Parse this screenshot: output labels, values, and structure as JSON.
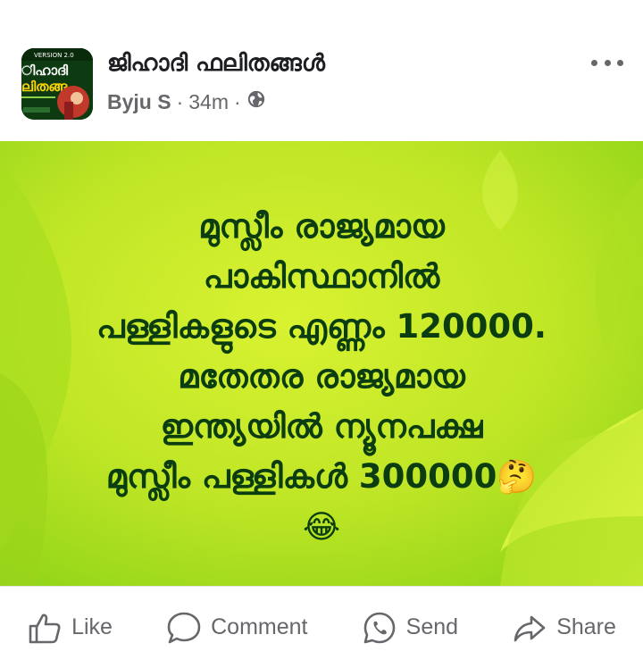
{
  "post": {
    "group_name": "ജിഹാദി ഫലിതങ്ങൾ",
    "author": "Byju S",
    "separator": "·",
    "time": "34m",
    "privacy_icon": "globe-icon",
    "more_icon": "more-options-icon",
    "avatar": {
      "badge_text": "VERSION 2.0",
      "title_line1": "ിഹാദി",
      "title_line2": "ലിതങ്ങ"
    },
    "text_lines": [
      "മുസ്ലീം രാജ്യമായ",
      "പാകിസ്ഥാനിൽ",
      "പള്ളികളുടെ എണ്ണം 120000.",
      "മതേതര രാജ്യമായ",
      "ഇന്ത്യയിൽ ന്യൂനപക്ഷ",
      "മുസ്ലീം പള്ളികൾ 300000"
    ],
    "emoji_thinking": "🤔",
    "emoji_laughing": "😂",
    "colors": {
      "text": "#0b3d10",
      "background_light": "#d7f02e",
      "background_dark": "#8fd418"
    }
  },
  "actions": {
    "like_label": "Like",
    "comment_label": "Comment",
    "send_label": "Send",
    "share_label": "Share"
  }
}
